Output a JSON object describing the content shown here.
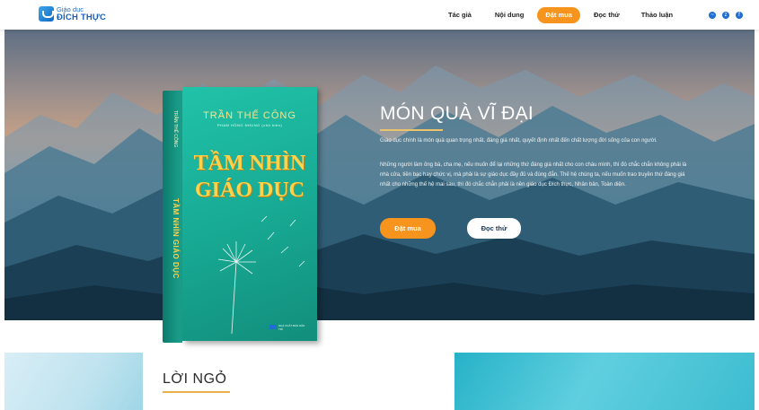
{
  "header": {
    "logo_line1": "Giáo dục",
    "logo_line2": "ĐÍCH THỰC",
    "nav": [
      "Tác giả",
      "Nội dung",
      "Đặt mua",
      "Đọc thử",
      "Thảo luận"
    ],
    "active_nav": "Đặt mua",
    "social_icons": [
      "messenger-icon",
      "zalo-icon",
      "facebook-icon"
    ]
  },
  "hero": {
    "title": "MÓN QUÀ VĨ ĐẠI",
    "paragraph1": "Giáo dục chính là món quà quan trọng nhất, đáng giá nhất, quyết định nhất đến chất lượng đời sống của con người.",
    "paragraph2": "Những người làm ông bà, cha mẹ, nếu muốn để lại những thứ đáng giá nhất cho con cháu mình, thì đó chắc chắn không phải là nhà cửa, tiền bạc hay chức vị, mà phải là sự giáo dục đầy đủ và đúng đắn. Thế hệ chúng ta, nếu muốn trao truyền thứ đáng giá nhất cho những thế hệ mai sau, thì đó chắc chắn phải là nền giáo dục Đích thực, Nhân bản, Toàn diện.",
    "buy_button": "Đặt mua",
    "read_button": "Đọc thử"
  },
  "book": {
    "author": "TRẦN THẾ CÔNG",
    "co_author": "PHẠM HỒNG NHUNG (chủ biên)",
    "title_line1": "TẦM NHÌN",
    "title_line2": "GIÁO DỤC",
    "spine_title": "TẦM NHÌN GIÁO DỤC",
    "spine_author": "TRẦN THẾ CÔNG",
    "publisher": "NHÀ XUẤT BẢN DÂN TRÍ"
  },
  "intro": {
    "title": "LỜI NGỎ"
  },
  "colors": {
    "accent": "#f7941d",
    "brand": "#1b6fc7",
    "book": "#1ba38e",
    "gold": "#e9c46a"
  }
}
